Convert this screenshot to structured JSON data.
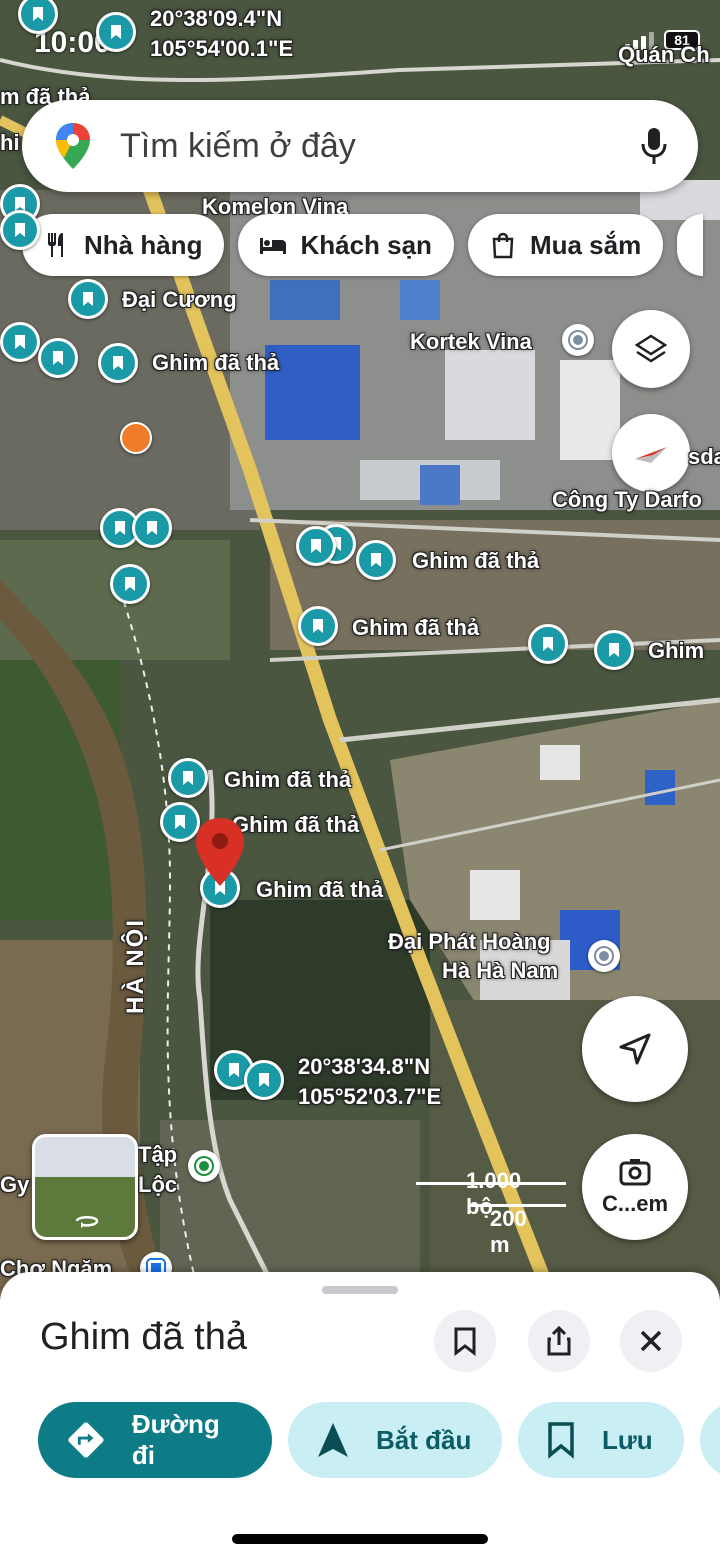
{
  "status_bar": {
    "time": "10:00",
    "battery": "81"
  },
  "search": {
    "placeholder": "Tìm kiếm ở đây"
  },
  "chips": [
    {
      "label": "Nhà hàng",
      "icon": "fork-knife-icon"
    },
    {
      "label": "Khách sạn",
      "icon": "bed-icon"
    },
    {
      "label": "Mua sắm",
      "icon": "shopping-bag-icon"
    }
  ],
  "map_labels": {
    "coord_top_lat": "20°38'09.4\"N",
    "coord_top_lng": "105°54'00.1\"E",
    "quan_ch": "Quán Ch",
    "m_da_tha": "m đã thả",
    "hi": "hi",
    "komelon": "Komelon Vina",
    "dai_cuong": "Đại Cương",
    "ghim_1": "Ghim đã thả",
    "kortek": "Kortek Vina",
    "sda": "sda",
    "darfo": "Công Ty Darfo",
    "ghim_2": "Ghim đã thả",
    "ghim_3": "Ghim đã thả",
    "ghim_right": "Ghim",
    "ghim_4": "Ghim đã thả",
    "ghim_5": "Ghim đã thả",
    "ghim_6": "Ghim đã thả",
    "ha_noi": "HÀ NỘI",
    "dai_phat_1": "Đại Phát Hoàng",
    "dai_phat_2": "Hà Hà Nam",
    "coord_bottom_lat": "20°38'34.8\"N",
    "coord_bottom_lng": "105°52'03.7\"E",
    "tap": "Tập",
    "loc": "Lộc",
    "gy": "Gy",
    "cho_ngam": "Chợ Ngăm"
  },
  "scale": {
    "imperial": "1.000 bộ",
    "metric": "200 m"
  },
  "camera_label": "C...em",
  "sheet": {
    "title": "Ghim đã thả",
    "actions": [
      {
        "label": "Đường đi",
        "icon": "directions-icon",
        "style": "primary"
      },
      {
        "label": "Bắt đầu",
        "icon": "navigation-arrow-icon",
        "style": "secondary"
      },
      {
        "label": "Lưu",
        "icon": "bookmark-icon",
        "style": "secondary"
      }
    ]
  },
  "colors": {
    "accent": "#0e7c87",
    "pin": "#1a9aa7",
    "red_pin": "#d93025",
    "secondary_button": "#c9eef3"
  }
}
